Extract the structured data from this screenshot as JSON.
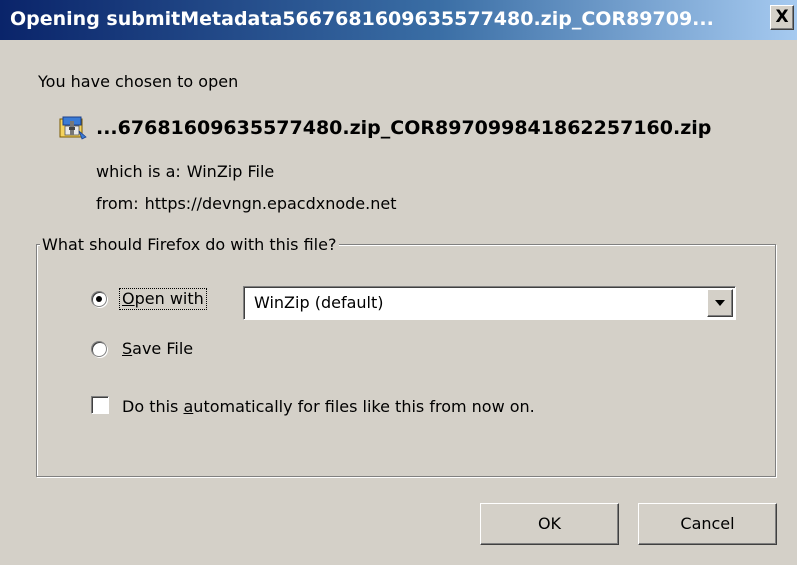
{
  "window": {
    "title": "Opening submitMetadata5667681609635577480.zip_COR89709...",
    "close_label": "X"
  },
  "file_info": {
    "intro": "You have chosen to open",
    "file_name": "...67681609635577480.zip_COR897099841862257160.zip",
    "file_icon": "winzip-file-icon",
    "type_label": "which is a:",
    "type_value": "WinZip File",
    "from_label": "from:",
    "from_value": "https://devngn.epacdxnode.net"
  },
  "action": {
    "group_label": "What should Firefox do with this file?",
    "open_with": {
      "prefix": "",
      "accel": "O",
      "rest": "pen with",
      "checked": true
    },
    "open_with_app": "WinZip (default)",
    "save_file": {
      "prefix": "",
      "accel": "S",
      "rest": "ave File",
      "checked": false
    },
    "auto": {
      "prefix": "Do this ",
      "accel": "a",
      "rest": "utomatically for files like this from now on.",
      "checked": false
    }
  },
  "buttons": {
    "ok": "OK",
    "cancel": "Cancel"
  }
}
